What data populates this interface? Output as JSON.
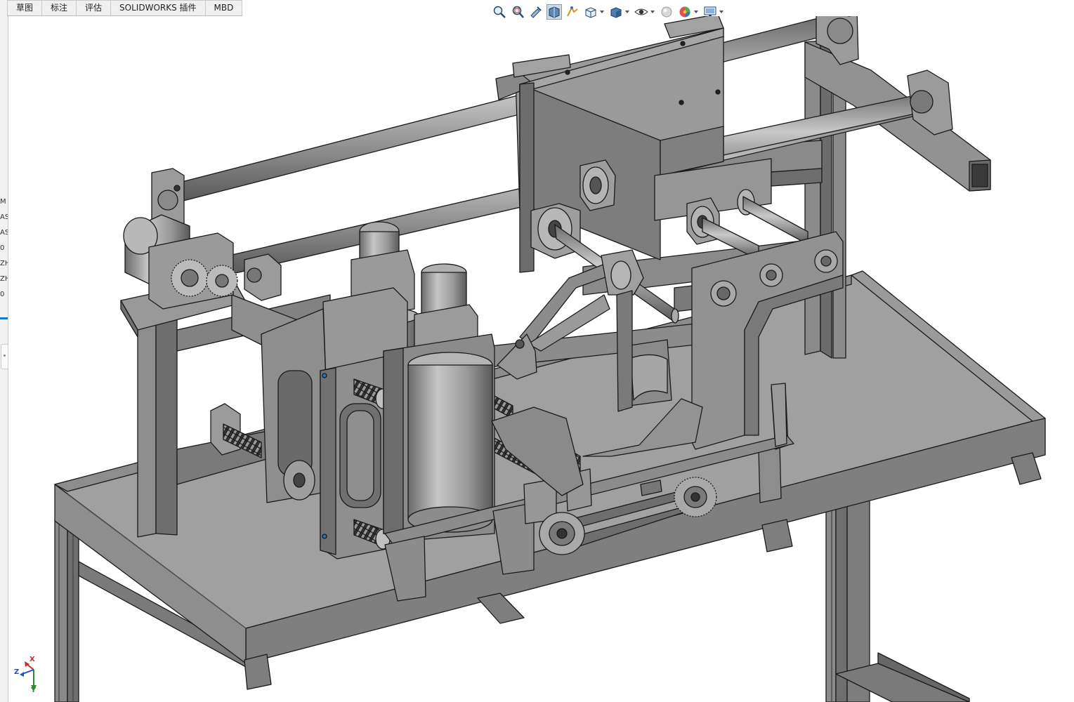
{
  "tabs": [
    {
      "label": "草图"
    },
    {
      "label": "标注"
    },
    {
      "label": "评估"
    },
    {
      "label": "SOLIDWORKS 插件"
    },
    {
      "label": "MBD"
    }
  ],
  "left_panel": {
    "items": [
      "M",
      "AS",
      "AS",
      "0",
      "ZH",
      "ZH",
      "0"
    ]
  },
  "hud_toolbar": [
    {
      "name": "zoom-to-fit-icon"
    },
    {
      "name": "zoom-to-area-icon"
    },
    {
      "name": "previous-view-icon"
    },
    {
      "name": "section-view-icon",
      "active": true
    },
    {
      "name": "dynamic-annotation-icon"
    },
    {
      "name": "view-orientation-icon",
      "caret": true
    },
    {
      "name": "display-style-icon",
      "caret": true
    },
    {
      "name": "hide-show-items-icon",
      "caret": true
    },
    {
      "name": "edit-appearance-icon"
    },
    {
      "name": "apply-scene-icon",
      "caret": true
    },
    {
      "name": "view-settings-icon",
      "caret": true
    }
  ],
  "triad": {
    "x": "X",
    "y": "Y",
    "z": "Z"
  },
  "colors": {
    "steel": "#8c8c8c",
    "steel_light": "#a9a9a9",
    "steel_dark": "#5e5e5e",
    "edge": "#1a1a1a",
    "accent_blue": "#1e78c8"
  }
}
